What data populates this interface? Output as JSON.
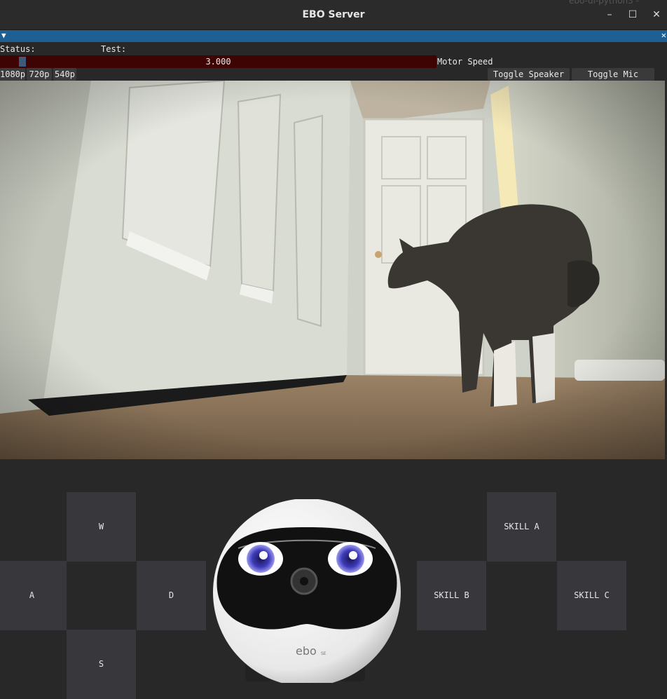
{
  "window": {
    "title": "EBO Server",
    "controls": [
      "–",
      "☐",
      "✕"
    ],
    "background_text": "ebo-ui-python3 -"
  },
  "panel": {
    "collapse_icon": "triangle-down-icon",
    "close_icon": "close-icon"
  },
  "status": {
    "status_label": "Status:",
    "test_label": "Test:"
  },
  "motor_speed": {
    "value": "3.000",
    "label": "Motor Speed",
    "level": 0.02
  },
  "resolution_buttons": [
    "1080p",
    "720p",
    "540p"
  ],
  "audio_buttons": {
    "speaker": "Toggle Speaker",
    "mic": "Toggle Mic"
  },
  "drive_pad": {
    "up": "W",
    "left": "A",
    "right": "D",
    "down": "S"
  },
  "skills": {
    "a": "SKILL A",
    "b": "SKILL B",
    "c": "SKILL C"
  },
  "robot": {
    "brand": "ebo",
    "model": "SE"
  },
  "colors": {
    "accent": "#1e5f94",
    "slider_bg": "#3e0404",
    "pad_bg": "#38383c"
  }
}
